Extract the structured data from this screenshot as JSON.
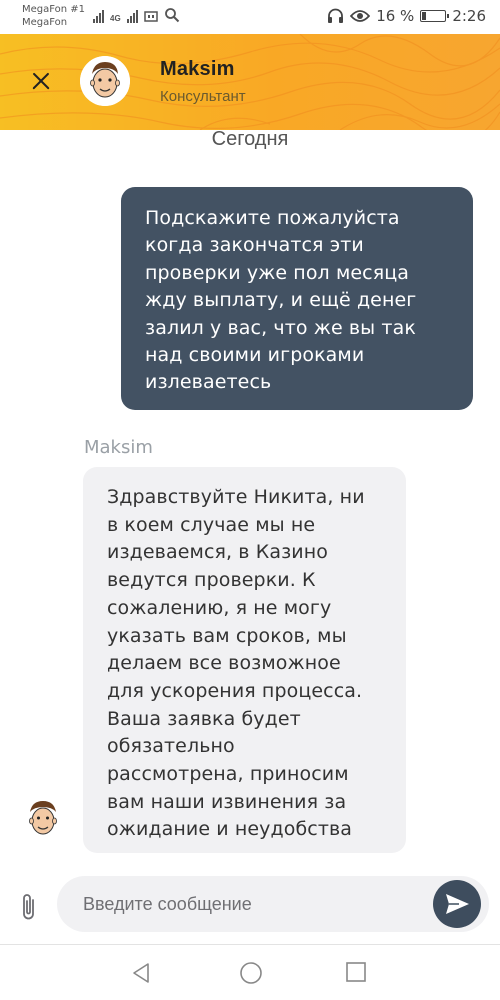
{
  "status_bar": {
    "carrier_1": "MegaFon #1",
    "carrier_2": "MegaFon",
    "network_label": "4G",
    "battery_text": "16 %",
    "time": "2:26"
  },
  "header": {
    "agent_name": "Maksim",
    "agent_role": "Консультант",
    "accent_color": "#f9a825"
  },
  "chat": {
    "date_separator": "Сегодня",
    "messages": [
      {
        "direction": "outgoing",
        "lines": [
          "Подскажите пожалуйста",
          "когда закончатся эти",
          "проверки уже пол месяца",
          "жду выплату, и ещё денег",
          "залил у вас, что же вы так",
          "над своими игроками",
          "излеваетесь"
        ],
        "bubble_color": "#435263"
      },
      {
        "direction": "incoming",
        "sender": "Maksim",
        "lines": [
          "Здравствуйте Никита, ни",
          "в коем случае мы не",
          "издеваемся, в Казино",
          "ведутся проверки. К",
          "сожалению, я не могу",
          "указать вам сроков, мы",
          "делаем все возможное",
          "для ускорения процесса.",
          "Ваша заявка будет",
          "обязательно",
          "рассмотрена, приносим",
          "вам наши извинения за",
          "ожидание и неудобства"
        ],
        "bubble_color": "#f1f1f3"
      }
    ]
  },
  "composer": {
    "placeholder": "Введите сообщение",
    "value": "",
    "attach_icon": "paperclip-icon",
    "send_icon": "send-icon"
  },
  "nav_bar": {
    "icons": [
      "back-triangle-icon",
      "home-circle-icon",
      "recent-square-icon"
    ]
  }
}
